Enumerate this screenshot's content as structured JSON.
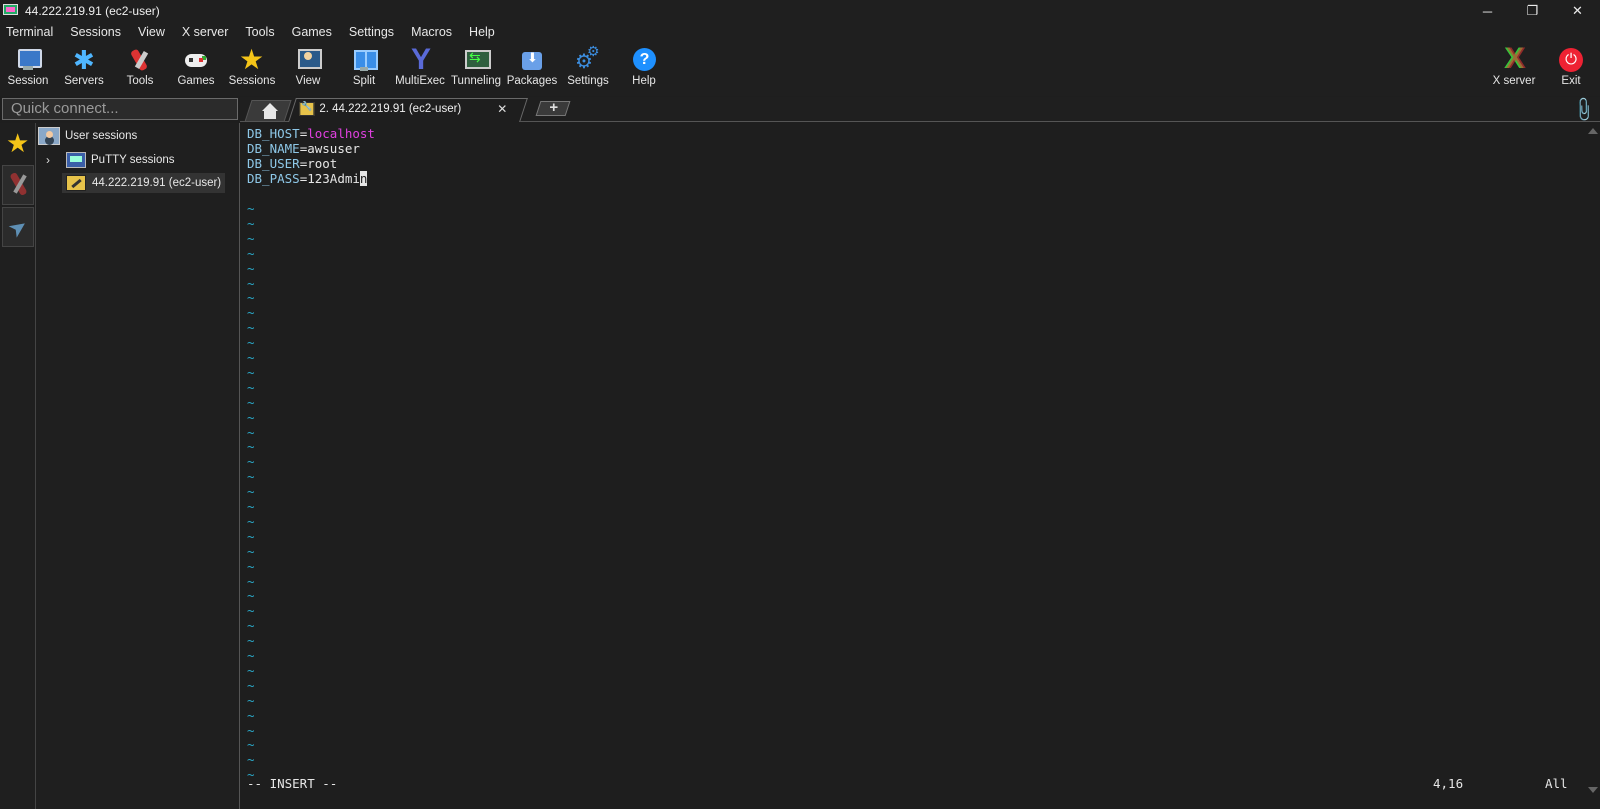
{
  "window": {
    "title": "44.222.219.91 (ec2-user)",
    "controls": {
      "minimize": "─",
      "restore": "❐",
      "close": "✕"
    }
  },
  "menu": [
    "Terminal",
    "Sessions",
    "View",
    "X server",
    "Tools",
    "Games",
    "Settings",
    "Macros",
    "Help"
  ],
  "toolbar": {
    "session": "Session",
    "servers": "Servers",
    "tools": "Tools",
    "games": "Games",
    "sessions": "Sessions",
    "view": "View",
    "split": "Split",
    "multiexec": "MultiExec",
    "tunneling": "Tunneling",
    "packages": "Packages",
    "settings": "Settings",
    "help": "Help",
    "xserver": "X server",
    "exit": "Exit"
  },
  "quick_connect": {
    "placeholder": "Quick connect..."
  },
  "tabs": {
    "session_tab_label": "2. 44.222.219.91 (ec2-user)",
    "close_glyph": "✕",
    "plus_glyph": "+"
  },
  "sidebar": {
    "user_sessions": "User sessions",
    "putty_sessions": "PuTTY sessions",
    "active_session": "44.222.219.91 (ec2-user)",
    "chevron": "›"
  },
  "terminal": {
    "lines": [
      {
        "key": "DB_HOST",
        "eq": "=",
        "value": "localhost"
      },
      {
        "key": "DB_NAME",
        "eq": "=",
        "value": "awsuser"
      },
      {
        "key": "DB_USER",
        "eq": "=",
        "value": "root"
      },
      {
        "key": "DB_PASS",
        "eq": "=",
        "value": "123Admi",
        "cursor_char": "n"
      }
    ],
    "tilde": "~",
    "mode": "-- INSERT --",
    "position": "4,16",
    "scroll": "All"
  },
  "icons": {
    "app": "mobaxterm-icon",
    "attach": "paperclip-icon"
  },
  "colors": {
    "background": "#1e1e1e",
    "keyword": "#8ec8e8",
    "string_pink": "#e040e0",
    "tilde": "#2aa8c8"
  }
}
